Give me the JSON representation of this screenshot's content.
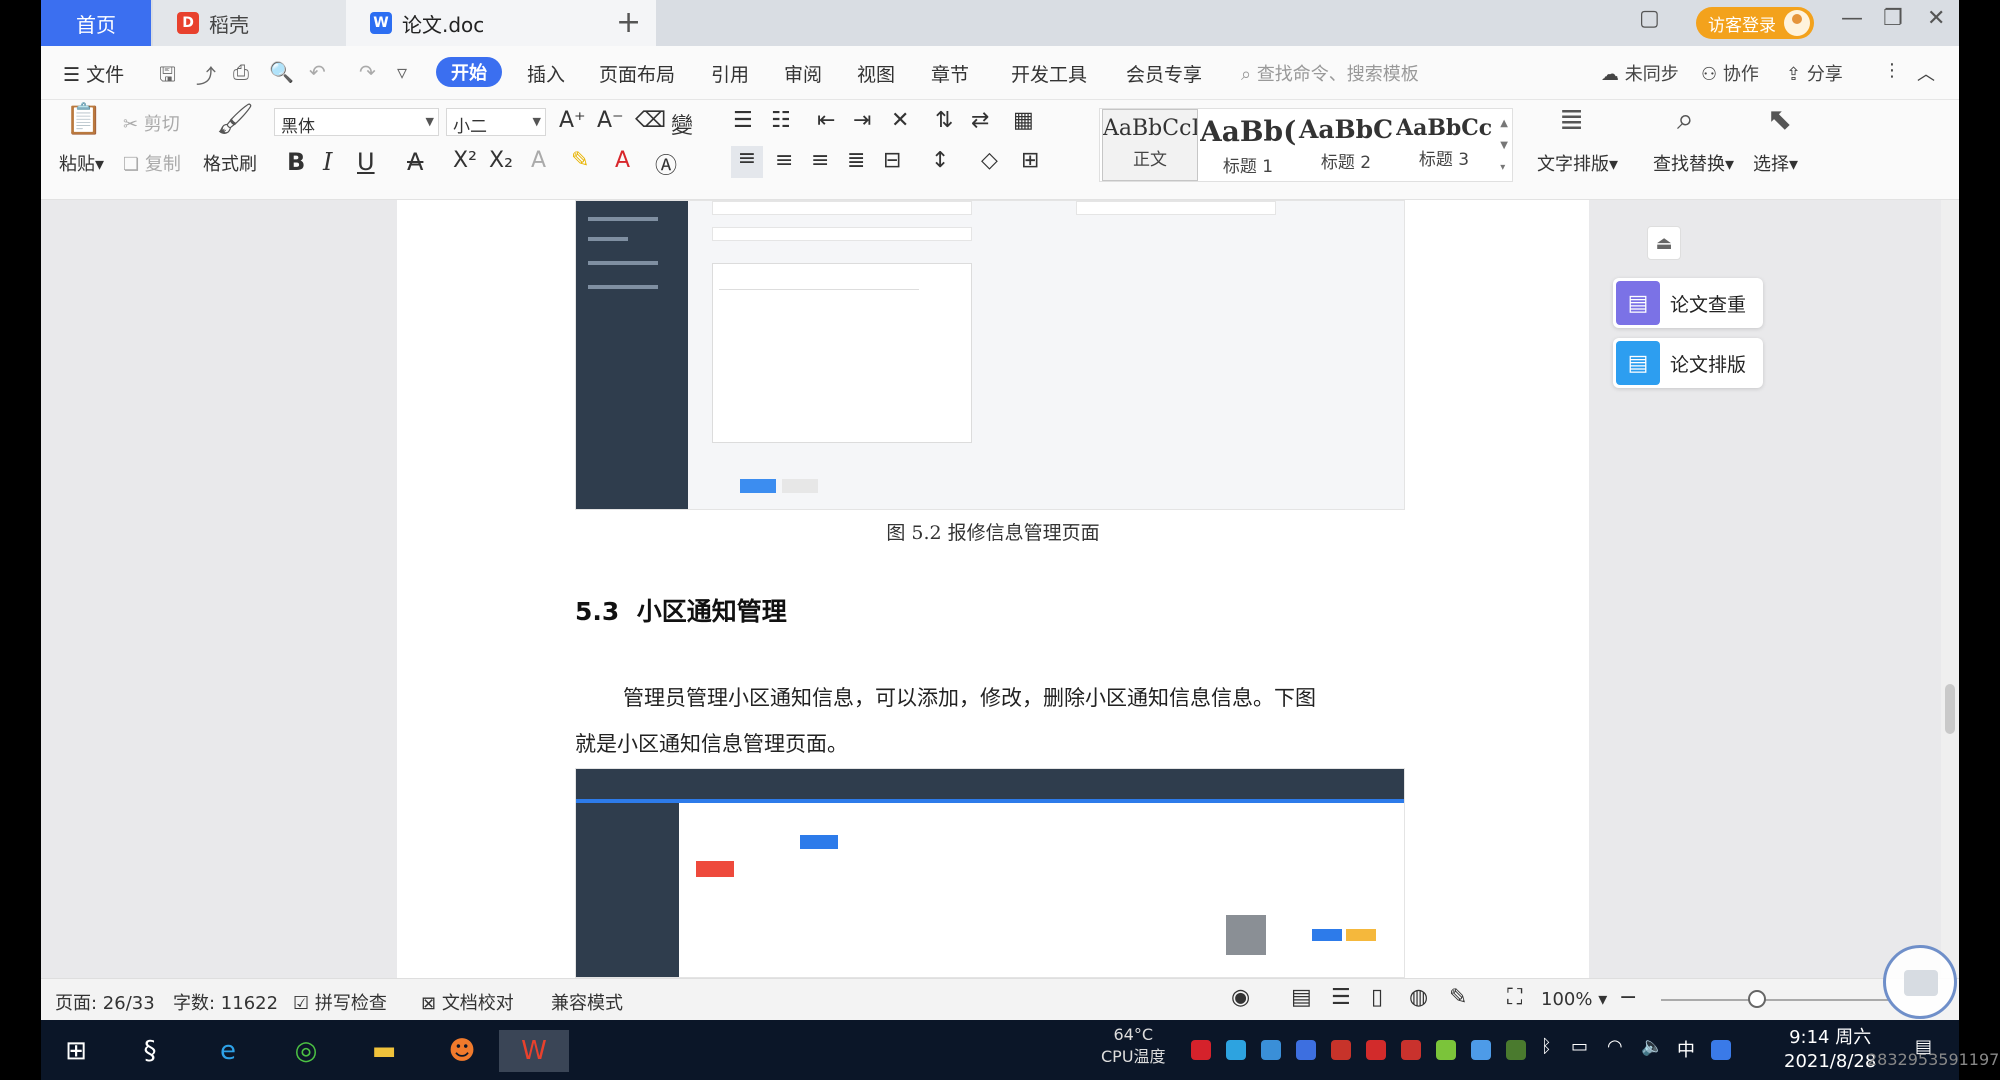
{
  "tabs": {
    "home": "首页",
    "daoke": "稻壳",
    "doc": "论文.doc",
    "login": "访客登录"
  },
  "menu": {
    "file": "文件",
    "items": [
      "开始",
      "插入",
      "页面布局",
      "引用",
      "审阅",
      "视图",
      "章节",
      "开发工具",
      "会员专享"
    ],
    "search_placeholder": "查找命令、搜索模板",
    "unsync": "未同步",
    "collab": "协作",
    "share": "分享"
  },
  "ribbon": {
    "paste": "粘贴",
    "cut": "剪切",
    "copy": "复制",
    "format_painter": "格式刷",
    "font_name": "黑体",
    "font_size": "小二",
    "styles": [
      {
        "preview": "AaBbCcI",
        "name": "正文"
      },
      {
        "preview": "AaBb(",
        "name": "标题 1"
      },
      {
        "preview": "AaBbC",
        "name": "标题 2"
      },
      {
        "preview": "AaBbCcl",
        "name": "标题 3"
      }
    ],
    "text_layout": "文字排版",
    "find_replace": "查找替换",
    "select": "选择"
  },
  "document": {
    "caption": "图 5.2 报修信息管理页面",
    "section_number": "5.3",
    "section_title": "小区通知管理",
    "para_line1": "管理员管理小区通知信息，可以添加，修改，删除小区通知信息信息。下图",
    "para_line2": "就是小区通知信息管理页面。"
  },
  "side_tools": {
    "check": "论文查重",
    "layout": "论文排版"
  },
  "status": {
    "page": "页面: 26/33",
    "words": "字数: 11622",
    "spell": "拼写检查",
    "proof": "文档校对",
    "compat": "兼容模式",
    "zoom": "100%"
  },
  "taskbar": {
    "cpu_temp": "64°C",
    "cpu_label": "CPU温度",
    "ime": "中",
    "time": "9:14 周六",
    "date": "2021/8/28",
    "overlay_id": "2832953591197"
  }
}
